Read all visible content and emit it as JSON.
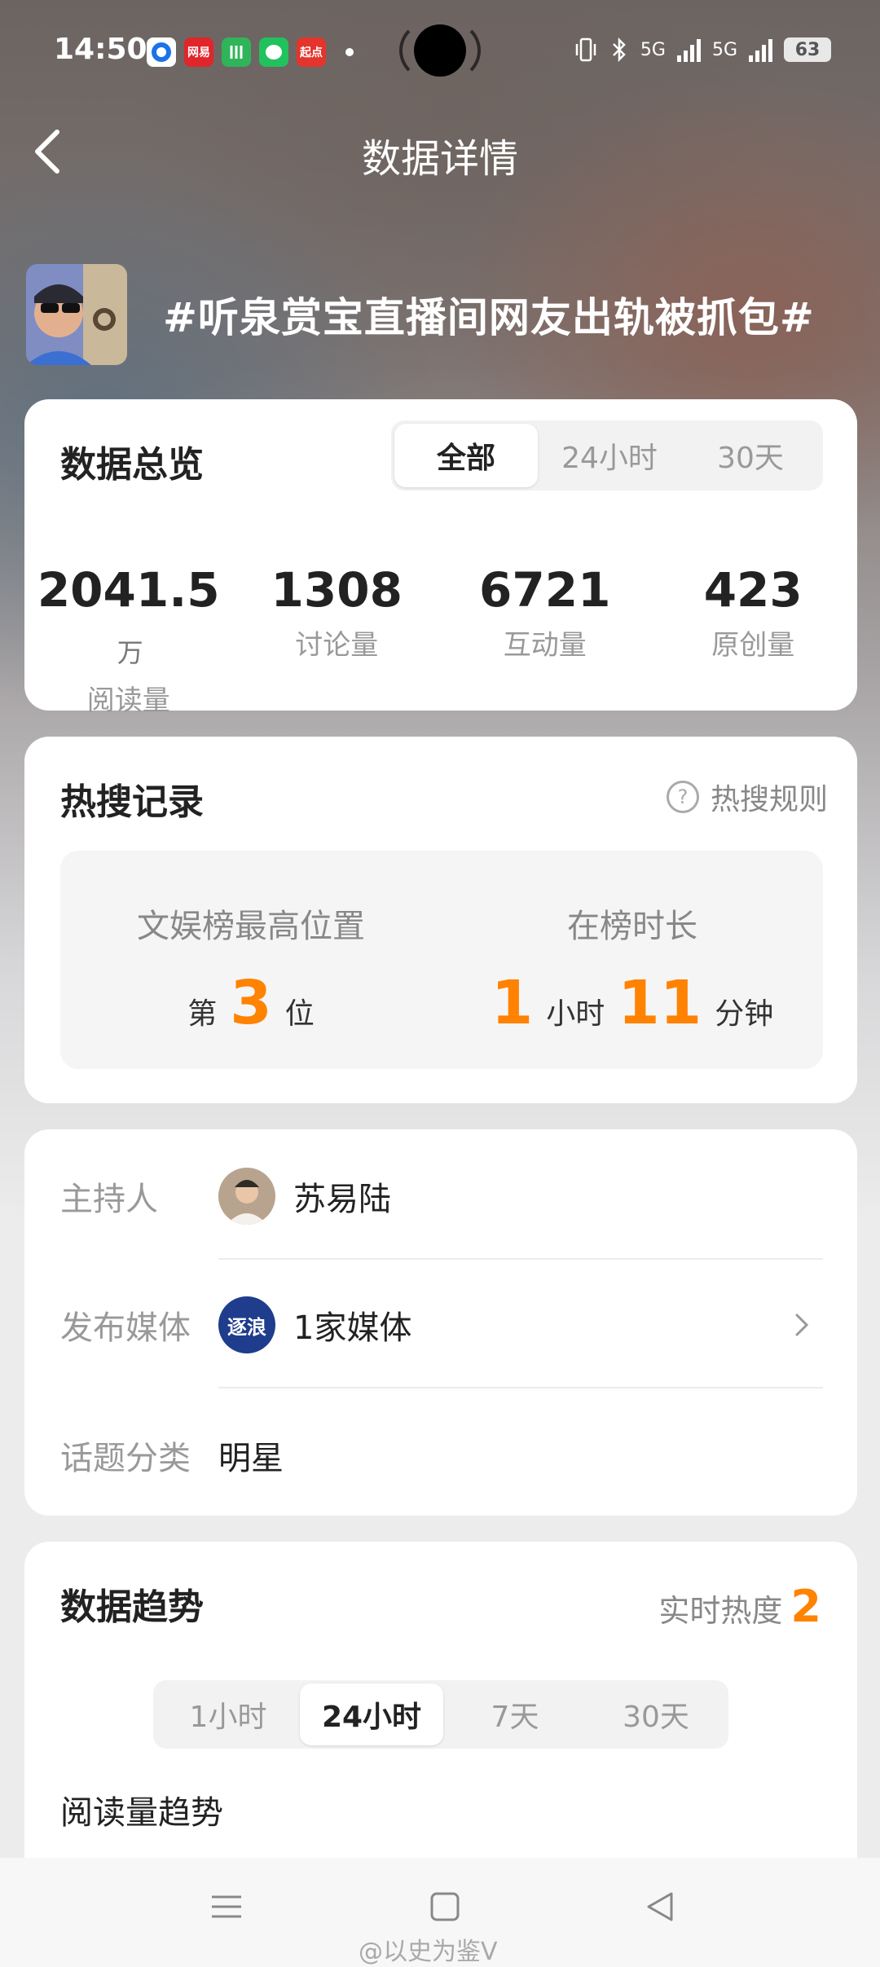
{
  "status_bar": {
    "time": "14:50",
    "app_icons": [
      "weibo-app-icon",
      "netease-news-icon",
      "meituan-icon",
      "wechat-icon",
      "qidian-icon"
    ],
    "app_labels": [
      "",
      "网易",
      "",
      "",
      "起点"
    ],
    "network": "5G",
    "battery": "63"
  },
  "header": {
    "title": "数据详情",
    "topic": "#听泉赏宝直播间网友出轨被抓包#"
  },
  "overview": {
    "title": "数据总览",
    "tabs": [
      "全部",
      "24小时",
      "30天"
    ],
    "active_tab": "全部",
    "stats": [
      {
        "value": "2041.5",
        "unit": "万",
        "label": "阅读量"
      },
      {
        "value": "1308",
        "unit": "",
        "label": "讨论量"
      },
      {
        "value": "6721",
        "unit": "",
        "label": "互动量"
      },
      {
        "value": "423",
        "unit": "",
        "label": "原创量"
      }
    ]
  },
  "hot_search": {
    "title": "热搜记录",
    "rules_label": "热搜规则",
    "best_position_label": "文娱榜最高位置",
    "best_position_prefix": "第",
    "best_position_value": "3",
    "best_position_suffix": "位",
    "duration_label": "在榜时长",
    "duration_hours": "1",
    "hours_unit": "小时",
    "duration_minutes": "11",
    "minutes_unit": "分钟"
  },
  "info": {
    "host_label": "主持人",
    "host_name": "苏易陆",
    "media_label": "发布媒体",
    "media_logo_text": "逐浪",
    "media_value": "1家媒体",
    "category_label": "话题分类",
    "category_value": "明星"
  },
  "trend": {
    "title": "数据趋势",
    "realtime_label": "实时热度",
    "realtime_value": "2",
    "tabs": [
      "1小时",
      "24小时",
      "7天",
      "30天"
    ],
    "active_tab": "24小时",
    "read_trend_label": "阅读量趋势"
  },
  "watermark": "@以史为鉴V",
  "colors": {
    "accent_orange": "#ff8200",
    "card_bg": "#ffffff",
    "page_bg": "#ececec"
  }
}
